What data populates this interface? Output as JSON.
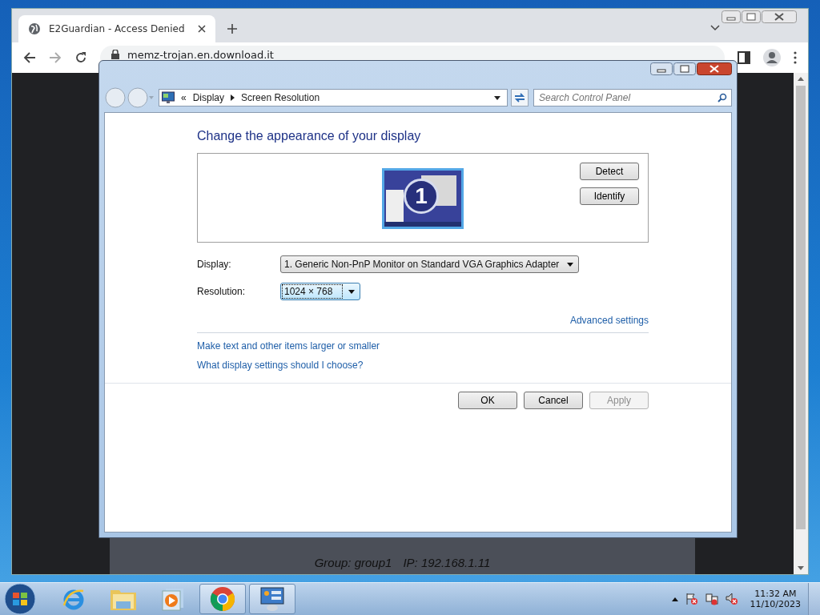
{
  "browser": {
    "tab": {
      "title": "E2Guardian - Access Denied",
      "selected": true
    },
    "address": "memz-trojan.en.download.it",
    "page_footer": [
      "Group: group1",
      "IP: 192.168.1.11"
    ]
  },
  "dialog": {
    "breadcrumb_overflow": "«",
    "breadcrumb": [
      "Display",
      "Screen Resolution"
    ],
    "search": {
      "placeholder": "Search Control Panel"
    },
    "heading": "Change the appearance of your display",
    "monitor_number": "1",
    "side_buttons": [
      {
        "label": "Detect"
      },
      {
        "label": "Identify"
      }
    ],
    "fields": [
      {
        "label": "Display:",
        "value": "1. Generic Non-PnP Monitor on Standard VGA Graphics Adapter",
        "focused": false
      },
      {
        "label": "Resolution:",
        "value": "1024 × 768",
        "focused": true
      }
    ],
    "advanced_link": "Advanced settings",
    "links": [
      "Make text and other items larger or smaller",
      "What display settings should I choose?"
    ],
    "footer_buttons": [
      {
        "label": "OK",
        "disabled": false
      },
      {
        "label": "Cancel",
        "disabled": false
      },
      {
        "label": "Apply",
        "disabled": true
      }
    ]
  },
  "taskbar": {
    "apps": [
      {
        "kind": "ie",
        "open": false
      },
      {
        "kind": "explorer",
        "open": false
      },
      {
        "kind": "media",
        "open": false
      },
      {
        "kind": "chrome",
        "open": true
      },
      {
        "kind": "control-panel",
        "open": true
      }
    ],
    "clock": {
      "time": "11:32 AM",
      "date": "11/10/2023"
    }
  }
}
